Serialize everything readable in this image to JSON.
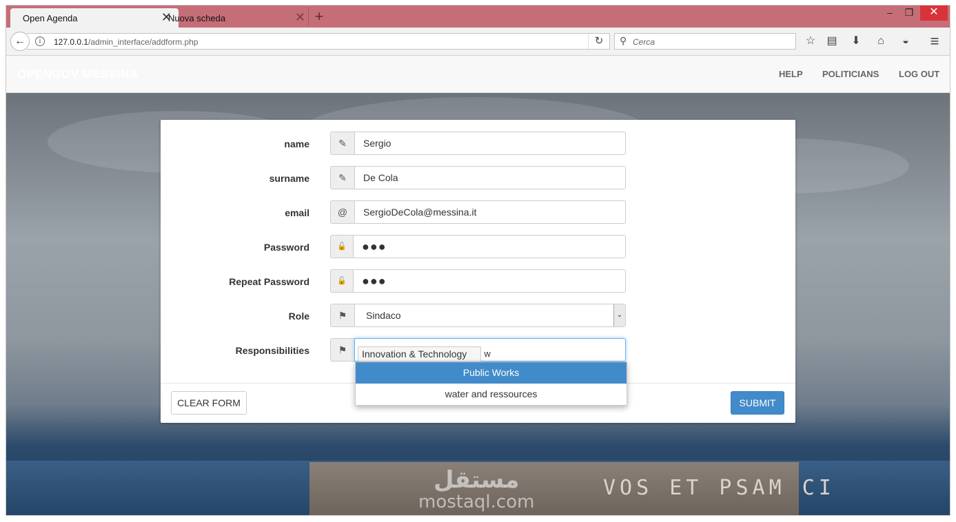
{
  "browser": {
    "tabs": [
      {
        "label": "Open Agenda",
        "active": true
      },
      {
        "label": "Nuova scheda",
        "active": false
      }
    ],
    "new_tab": "+",
    "url_host": "127.0.0.1",
    "url_path": "/admin_interface/addform.php",
    "search_placeholder": "Cerca",
    "icons": {
      "back": "←",
      "info": "i",
      "reload": "↻",
      "search": "⚲",
      "star": "☆",
      "reading_list": "▤",
      "download": "⬇",
      "home": "⌂",
      "pocket": "◒",
      "menu": "≡",
      "close": "✕",
      "minimize": "–",
      "maximize": "❐"
    },
    "accent_color": "#c66e78"
  },
  "site": {
    "brand": "OPENGOV MESSINA",
    "nav": [
      "HELP",
      "POLITICIANS",
      "LOG OUT"
    ],
    "watermark_ar": "مستقل",
    "watermark_en": "mostaql.com",
    "background_text": "VOS ET PSAM CI"
  },
  "form": {
    "fields": {
      "name": {
        "label": "name",
        "value": "Sergio",
        "icon": "pencil-icon",
        "glyph": "✎"
      },
      "surname": {
        "label": "surname",
        "value": "De Cola",
        "icon": "pencil-icon",
        "glyph": "✎"
      },
      "email": {
        "label": "email",
        "value": "SergioDeCola@messina.it",
        "icon": "at-icon",
        "glyph": "@"
      },
      "password": {
        "label": "Password",
        "value": "●●●",
        "icon": "lock-icon",
        "glyph": "🔓"
      },
      "repeat_password": {
        "label": "Repeat Password",
        "value": "●●●",
        "icon": "lock-icon",
        "glyph": "🔓"
      },
      "role": {
        "label": "Role",
        "value": "Sindaco",
        "icon": "flag-icon",
        "glyph": "⚑",
        "caret": "⌄"
      },
      "responsibilities": {
        "label": "Responsibilities",
        "tags": [
          "Innovation & Technology"
        ],
        "typed": "w",
        "icon": "flag-icon",
        "glyph": "⚑"
      }
    },
    "suggestions": [
      "Public Works",
      "water and ressources"
    ],
    "clear_label": "CLEAR FORM",
    "submit_label": "SUBMIT",
    "submit_color": "#428bca"
  }
}
